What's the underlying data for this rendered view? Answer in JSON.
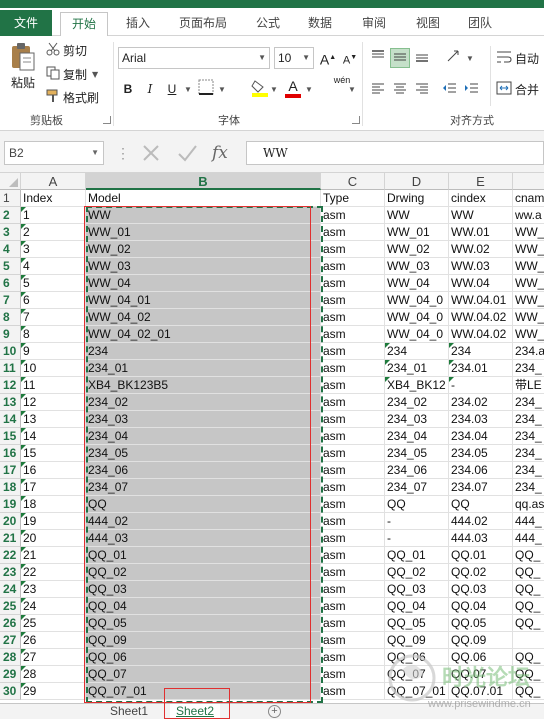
{
  "ribbon_tabs": [
    "文件",
    "开始",
    "插入",
    "页面布局",
    "公式",
    "数据",
    "审阅",
    "视图",
    "团队"
  ],
  "clipboard": {
    "cut": "剪切",
    "copy": "复制",
    "paste": "粘贴",
    "format_painter": "格式刷",
    "group": "剪贴板"
  },
  "font": {
    "name": "Arial",
    "size": "10",
    "group": "字体",
    "bold": "B",
    "italic": "I",
    "underline": "U",
    "grow": "A",
    "shrink": "A",
    "phonetic": "wén",
    "font_color": "A"
  },
  "alignment": {
    "wrap": "自动",
    "merge": "合并",
    "group": "对齐方式"
  },
  "namebox": "B2",
  "formula": "WW",
  "fx": "fx",
  "columns": [
    "A",
    "B",
    "C",
    "D",
    "E",
    "F"
  ],
  "header_row": [
    "Index",
    "Model",
    "Type",
    "Drwing",
    "cindex",
    "cnam"
  ],
  "rows": [
    [
      "1",
      "WW",
      "asm",
      "WW",
      "WW",
      "ww.a"
    ],
    [
      "2",
      "WW_01",
      "asm",
      "WW_01",
      "WW.01",
      "WW_"
    ],
    [
      "3",
      "WW_02",
      "asm",
      "WW_02",
      "WW.02",
      "WW_"
    ],
    [
      "4",
      "WW_03",
      "asm",
      "WW_03",
      "WW.03",
      "WW_"
    ],
    [
      "5",
      "WW_04",
      "asm",
      "WW_04",
      "WW.04",
      "WW_"
    ],
    [
      "6",
      "WW_04_01",
      "asm",
      "WW_04_0",
      "WW.04.01",
      "WW_"
    ],
    [
      "7",
      "WW_04_02",
      "asm",
      "WW_04_0",
      "WW.04.02",
      "WW_"
    ],
    [
      "8",
      "WW_04_02_01",
      "asm",
      "WW_04_0",
      "WW.04.02",
      "WW_"
    ],
    [
      "9",
      "234",
      "asm",
      "234",
      "234",
      "234.a"
    ],
    [
      "10",
      "234_01",
      "asm",
      "234_01",
      "234.01",
      "234_"
    ],
    [
      "11",
      "XB4_BK123B5",
      "asm",
      "XB4_BK12",
      "-",
      "带LE"
    ],
    [
      "12",
      "234_02",
      "asm",
      "234_02",
      "234.02",
      "234_"
    ],
    [
      "13",
      "234_03",
      "asm",
      "234_03",
      "234.03",
      "234_"
    ],
    [
      "14",
      "234_04",
      "asm",
      "234_04",
      "234.04",
      "234_"
    ],
    [
      "15",
      "234_05",
      "asm",
      "234_05",
      "234.05",
      "234_"
    ],
    [
      "16",
      "234_06",
      "asm",
      "234_06",
      "234.06",
      "234_"
    ],
    [
      "17",
      "234_07",
      "asm",
      "234_07",
      "234.07",
      "234_"
    ],
    [
      "18",
      "QQ",
      "asm",
      "QQ",
      "QQ",
      "qq.as"
    ],
    [
      "19",
      "444_02",
      "asm",
      "-",
      "444.02",
      "444_"
    ],
    [
      "20",
      "444_03",
      "asm",
      "-",
      "444.03",
      "444_"
    ],
    [
      "21",
      "QQ_01",
      "asm",
      "QQ_01",
      "QQ.01",
      "QQ_"
    ],
    [
      "22",
      "QQ_02",
      "asm",
      "QQ_02",
      "QQ.02",
      "QQ_"
    ],
    [
      "23",
      "QQ_03",
      "asm",
      "QQ_03",
      "QQ.03",
      "QQ_"
    ],
    [
      "24",
      "QQ_04",
      "asm",
      "QQ_04",
      "QQ.04",
      "QQ_"
    ],
    [
      "25",
      "QQ_05",
      "asm",
      "QQ_05",
      "QQ.05",
      "QQ_"
    ],
    [
      "26",
      "QQ_09",
      "asm",
      "QQ_09",
      "QQ.09",
      ""
    ],
    [
      "27",
      "QQ_06",
      "asm",
      "QQ_06",
      "QQ.06",
      "QQ_"
    ],
    [
      "28",
      "QQ_07",
      "asm",
      "QQ_07",
      "QQ.07",
      "QQ_"
    ],
    [
      "29",
      "QQ_07_01",
      "asm",
      "QQ_07_01",
      "QQ.07.01",
      "QQ_"
    ]
  ],
  "sheets": [
    "Sheet1",
    "Sheet2"
  ],
  "active_sheet": "Sheet2",
  "watermark": {
    "title": "时光论坛",
    "url": "www.prisewindme.cn"
  },
  "colors": {
    "accent": "#217346",
    "selection": "#c6c6c6",
    "red_box": "#e03030"
  }
}
